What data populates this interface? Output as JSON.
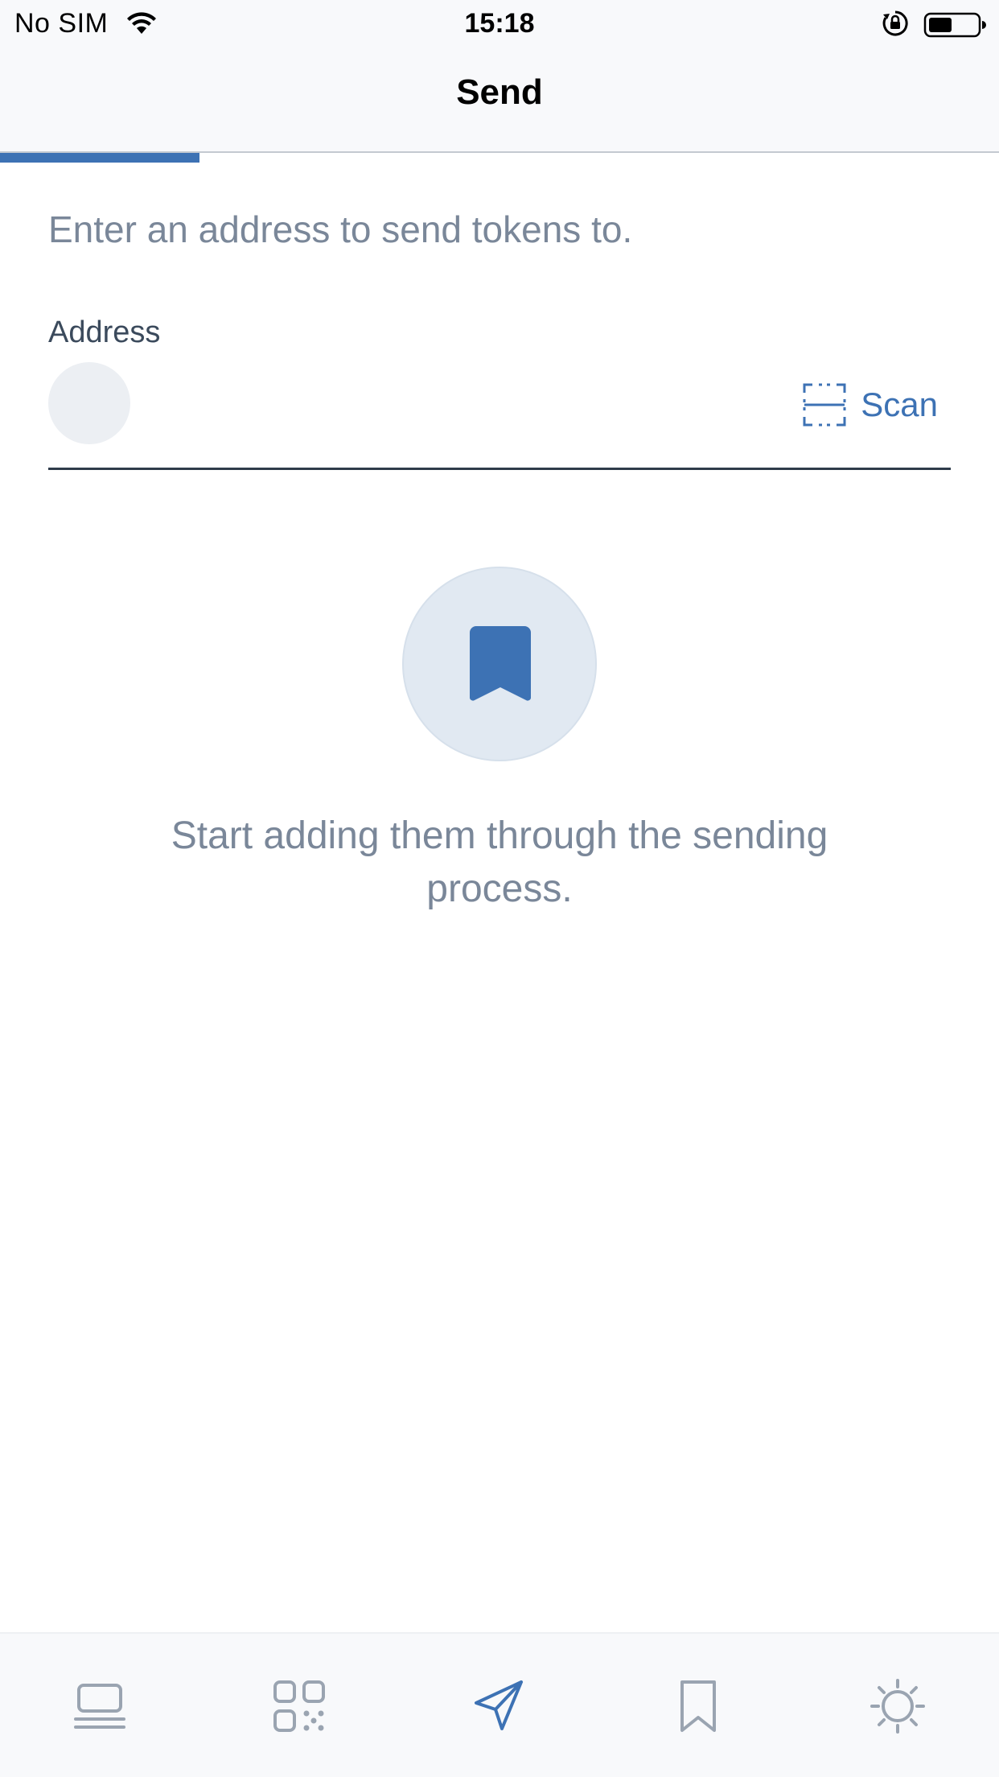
{
  "status_bar": {
    "carrier": "No SIM",
    "time": "15:18",
    "icons": [
      "wifi-icon",
      "orientation-lock-icon",
      "battery-icon"
    ]
  },
  "header": {
    "title": "Send"
  },
  "progress": {
    "fraction": 0.2
  },
  "send_form": {
    "instruction": "Enter an address to send tokens to.",
    "address_label": "Address",
    "address_value": "",
    "scan_label": "Scan"
  },
  "empty_state": {
    "icon": "bookmark-icon",
    "message": "Start adding them through the sending process."
  },
  "tab_bar": {
    "tabs": [
      {
        "icon": "wallet-icon",
        "active": false
      },
      {
        "icon": "qr-code-icon",
        "active": false
      },
      {
        "icon": "send-icon",
        "active": true
      },
      {
        "icon": "bookmark-icon",
        "active": false
      },
      {
        "icon": "settings-icon",
        "active": false
      }
    ]
  },
  "colors": {
    "accent": "#3d72b4",
    "muted_text": "#7a8799",
    "inactive_icon": "#9aa4b1",
    "header_bg": "#f8f9fb"
  }
}
